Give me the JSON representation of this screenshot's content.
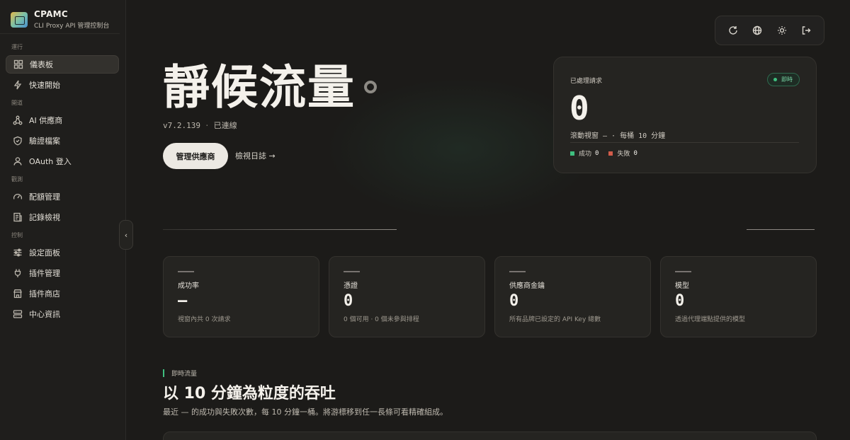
{
  "brand": {
    "name": "CPAMC",
    "subtitle": "CLI Proxy API 管理控制台"
  },
  "sidebar": {
    "sections": [
      {
        "label": "運行",
        "items": [
          {
            "label": "儀表板",
            "icon": "grid-icon",
            "active": true
          },
          {
            "label": "快速開始",
            "icon": "lightning-icon"
          }
        ]
      },
      {
        "label": "開道",
        "items": [
          {
            "label": "AI 供應商",
            "icon": "nodes-icon"
          },
          {
            "label": "驗證檔案",
            "icon": "shield-icon"
          },
          {
            "label": "OAuth 登入",
            "icon": "user-icon"
          }
        ]
      },
      {
        "label": "觀測",
        "items": [
          {
            "label": "配額管理",
            "icon": "gauge-icon"
          },
          {
            "label": "記錄檢視",
            "icon": "log-icon"
          }
        ]
      },
      {
        "label": "控制",
        "items": [
          {
            "label": "設定面板",
            "icon": "sliders-icon"
          },
          {
            "label": "插件管理",
            "icon": "plug-icon"
          },
          {
            "label": "插件商店",
            "icon": "store-icon"
          },
          {
            "label": "中心資訊",
            "icon": "server-icon"
          }
        ]
      }
    ],
    "collapse_glyph": "‹"
  },
  "toolbar": {
    "icons": [
      "refresh-icon",
      "globe-icon",
      "sun-icon",
      "logout-icon"
    ]
  },
  "hero": {
    "title": "靜候流量",
    "version": "v7.2.139",
    "separator": "·",
    "status": "已連線",
    "primary_button": "管理供應商",
    "secondary_link": "檢視日誌 →"
  },
  "requests": {
    "label": "已處理請求",
    "badge": "即時",
    "value": "0",
    "window": "滾動視窗 — · 每桶 10 分鐘",
    "success_label": "成功",
    "success_value": "0",
    "fail_label": "失敗",
    "fail_value": "0"
  },
  "stats": [
    {
      "label": "成功率",
      "value": "—",
      "desc": "視窗內共 0 次請求"
    },
    {
      "label": "憑證",
      "value": "0",
      "desc": "0 個可用 · 0 個未參與排程"
    },
    {
      "label": "供應商金鑰",
      "value": "0",
      "desc": "所有品牌已設定的 API Key 總數"
    },
    {
      "label": "模型",
      "value": "0",
      "desc": "透過代理端點提供的模型"
    }
  ],
  "live": {
    "kicker": "即時流量",
    "title": "以 10 分鐘為粒度的吞吐",
    "subtitle": "最近 — 的成功與失敗次數，每 10 分鐘一桶。將游標移到任一長條可看精確組成。"
  },
  "colors": {
    "accent_green": "#3fbf7f",
    "fail_red": "#d25c4a",
    "background": "#1c1b19"
  }
}
